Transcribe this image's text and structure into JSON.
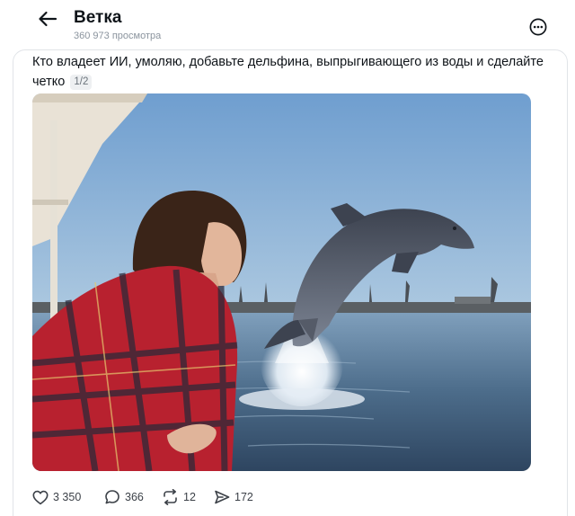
{
  "header": {
    "title": "Ветка",
    "views": "360 973 просмотра"
  },
  "post": {
    "text": "Кто владеет ИИ, умоляю, добавьте дельфина, выпрыгивающего из воды и сделайте четко",
    "media_counter": "1/2",
    "media_icon": "photo-girl-dolphin"
  },
  "actions": {
    "likes": "3 350",
    "replies": "366",
    "reposts": "12",
    "shares": "172"
  },
  "icons": {
    "back": "arrow-left-icon",
    "more": "more-circle-icon",
    "like": "heart-icon",
    "reply": "comment-icon",
    "repost": "repost-icon",
    "share": "send-icon"
  },
  "colors": {
    "text": "#0f1419",
    "muted": "#8b949e",
    "border": "#e1e4e8"
  }
}
